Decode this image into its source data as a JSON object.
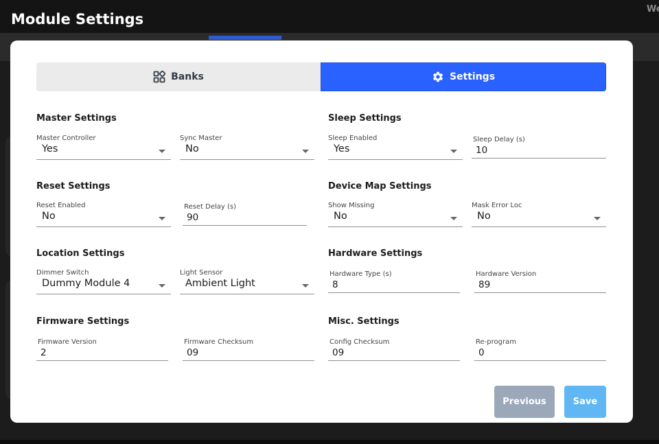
{
  "app": {
    "title": "Module Settings",
    "top_right_text": "We"
  },
  "tabs": [
    {
      "label": "Banks",
      "icon": "grid-icon",
      "active": false
    },
    {
      "label": "Settings",
      "icon": "gear-icon",
      "active": true
    }
  ],
  "colors": {
    "accent": "#2962ff",
    "previous_button": "#9aa8b9",
    "save_button": "#60b7f4"
  },
  "sections": {
    "master": {
      "title": "Master Settings",
      "master_controller": {
        "label": "Master Controller",
        "value": "Yes"
      },
      "sync_master": {
        "label": "Sync Master",
        "value": "No"
      }
    },
    "sleep": {
      "title": "Sleep Settings",
      "sleep_enabled": {
        "label": "Sleep Enabled",
        "value": "Yes"
      },
      "sleep_delay": {
        "label": "Sleep Delay (s)",
        "value": "10"
      }
    },
    "reset": {
      "title": "Reset Settings",
      "reset_enabled": {
        "label": "Reset Enabled",
        "value": "No"
      },
      "reset_delay": {
        "label": "Reset Delay (s)",
        "value": "90"
      }
    },
    "device_map": {
      "title": "Device Map Settings",
      "show_missing": {
        "label": "Show Missing",
        "value": "No"
      },
      "mask_error_loc": {
        "label": "Mask Error Loc",
        "value": "No"
      }
    },
    "location": {
      "title": "Location Settings",
      "dimmer_switch": {
        "label": "Dimmer Switch",
        "value": "Dummy Module 4"
      },
      "light_sensor": {
        "label": "Light Sensor",
        "value": "Ambient Light"
      }
    },
    "hardware": {
      "title": "Hardware Settings",
      "hardware_type": {
        "label": "Hardware Type (s)",
        "value": "8"
      },
      "hardware_version": {
        "label": "Hardware Version",
        "value": "89"
      }
    },
    "firmware": {
      "title": "Firmware Settings",
      "firmware_version": {
        "label": "Firmware Version",
        "value": "2"
      },
      "firmware_checksum": {
        "label": "Firmware Checksum",
        "value": "09"
      }
    },
    "misc": {
      "title": "Misc. Settings",
      "config_checksum": {
        "label": "Config Checksum",
        "value": "09"
      },
      "reprogram": {
        "label": "Re-program",
        "value": "0"
      }
    }
  },
  "buttons": {
    "previous": "Previous",
    "save": "Save"
  }
}
